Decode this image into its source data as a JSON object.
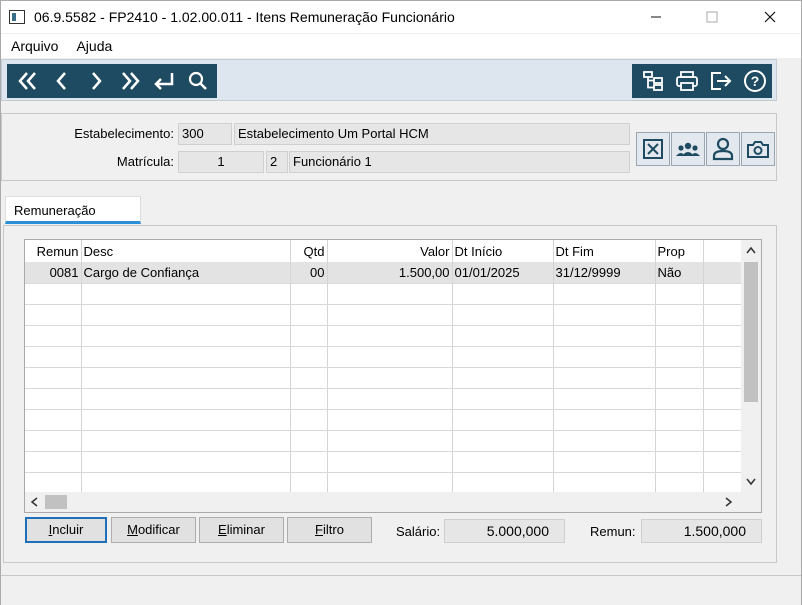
{
  "window": {
    "title": "06.9.5582 - FP2410 - 1.02.00.011 - Itens Remuneração Funcionário",
    "minimize_glyph": "—",
    "maximize_glyph": "☐",
    "close_glyph": "✕"
  },
  "menu": {
    "items": [
      "Arquivo",
      "Ajuda"
    ]
  },
  "header": {
    "estabelecimento_label": "Estabelecimento:",
    "estabelecimento_code": "300",
    "estabelecimento_name": "Estabelecimento Um Portal HCM",
    "matricula_label": "Matrícula:",
    "matricula_value": "1",
    "matricula_seq": "2",
    "funcionario_name": "Funcionário 1"
  },
  "tabs": [
    {
      "label": "Remuneração",
      "active": true
    }
  ],
  "grid": {
    "columns": [
      "Remun",
      "Desc",
      "Qtd",
      "Valor",
      "Dt Início",
      "Dt Fim",
      "Prop"
    ],
    "rows": [
      [
        "0081",
        "Cargo de Confiança",
        "00",
        "1.500,00",
        "01/01/2025",
        "31/12/9999",
        "Não"
      ]
    ],
    "empty_rows": 10
  },
  "actions": {
    "incluir_pre": "",
    "incluir_key": "I",
    "incluir_post": "ncluir",
    "modificar_pre": "",
    "modificar_key": "M",
    "modificar_post": "odificar",
    "eliminar_pre": "",
    "eliminar_key": "E",
    "eliminar_post": "liminar",
    "filtro_pre": "",
    "filtro_key": "F",
    "filtro_post": "iltro"
  },
  "totals": {
    "salario_label": "Salário:",
    "salario_value": "5.000,000",
    "remun_label": "Remun:",
    "remun_value": "1.500,000"
  },
  "colors": {
    "toolbar_bg": "#1f4b62",
    "tab_accent": "#2b8fd6",
    "primary_button_border": "#1f6fb8"
  },
  "icons": {
    "nav": [
      "first-record-icon",
      "previous-record-icon",
      "next-record-icon",
      "last-record-icon",
      "return-icon",
      "search-icon"
    ],
    "tools": [
      "tree-structure-icon",
      "printer-icon",
      "exit-icon",
      "help-icon"
    ],
    "side": [
      "close-box-icon",
      "group-users-icon",
      "user-icon",
      "camera-icon"
    ]
  }
}
